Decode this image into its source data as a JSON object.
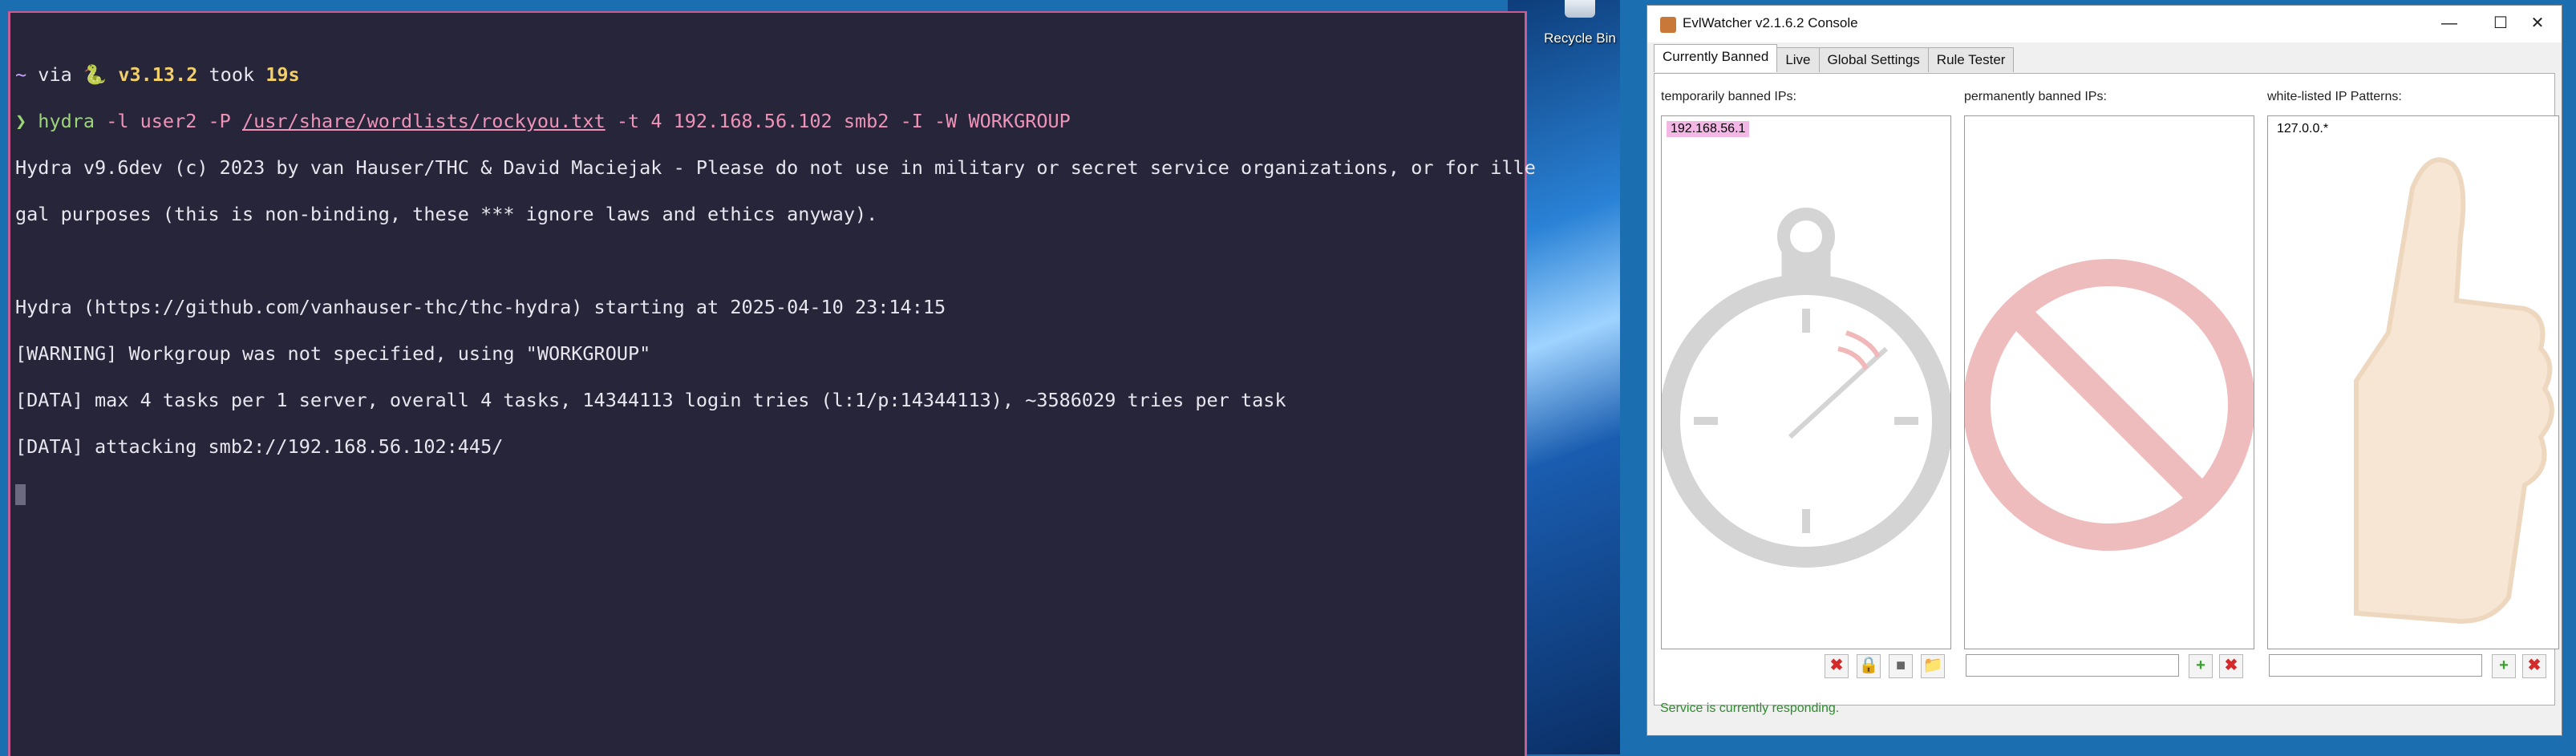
{
  "terminal": {
    "prompt": {
      "tilde": "~",
      "via": " via ",
      "python_icon": "🐍",
      "version": "v3.13.2",
      "took": " took ",
      "duration": "19s"
    },
    "command": {
      "arrow": "❯ ",
      "program": "hydra",
      "args1": " -l user2 -P ",
      "wordlist": "/usr/share/wordlists/rockyou.txt",
      "args2": " -t 4 192.168.56.102 smb2 -I -W WORKGROUP"
    },
    "output": [
      "Hydra v9.6dev (c) 2023 by van Hauser/THC & David Maciejak - Please do not use in military or secret service organizations, or for ille",
      "gal purposes (this is non-binding, these *** ignore laws and ethics anyway).",
      "",
      "Hydra (https://github.com/vanhauser-thc/thc-hydra) starting at 2025-04-10 23:14:15",
      "[WARNING] Workgroup was not specified, using \"WORKGROUP\"",
      "[DATA] max 4 tasks per 1 server, overall 4 tasks, 14344113 login tries (l:1/p:14344113), ~3586029 tries per task",
      "[DATA] attacking smb2://192.168.56.102:445/"
    ]
  },
  "desktop": {
    "recycle_bin_label": "Recycle Bin",
    "recycle_bin_icon": "recycle-bin-icon"
  },
  "window": {
    "title": "EvlWatcher v2.1.6.2 Console",
    "minimize": "—",
    "maximize": "☐",
    "close": "✕",
    "tabs": [
      {
        "label": "Currently Banned"
      },
      {
        "label": "Live"
      },
      {
        "label": "Global Settings"
      },
      {
        "label": "Rule Tester"
      }
    ],
    "columns": {
      "temporary": {
        "label": "temporarily banned IPs:",
        "items": [
          "192.168.56.1"
        ]
      },
      "permanent": {
        "label": "permanently banned IPs:",
        "items": [],
        "input_value": ""
      },
      "whitelist": {
        "label": "white-listed IP Patterns:",
        "items": [
          "127.0.0.*"
        ],
        "input_value": ""
      }
    },
    "status": "Service is currently responding.",
    "colors": {
      "banned_highlight": "#f3b7e6",
      "status_text": "#2f8a2f",
      "terminal_bg": "#262539"
    }
  }
}
